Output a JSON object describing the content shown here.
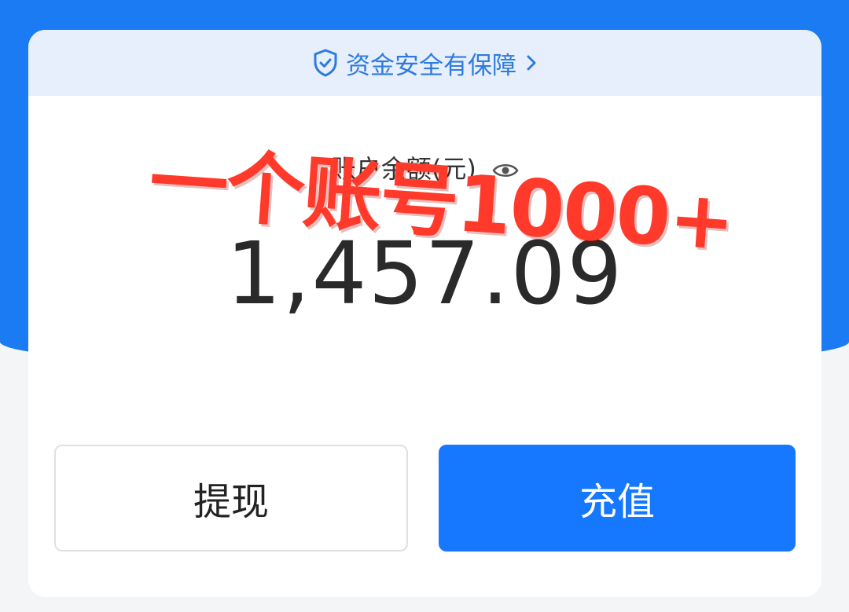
{
  "safety": {
    "label": "资金安全有保障"
  },
  "balance": {
    "label": "账户余额(元)",
    "value": "1,457.09"
  },
  "overlay": {
    "text": "一个账号1000+"
  },
  "buttons": {
    "withdraw": "提现",
    "recharge": "充值"
  },
  "colors": {
    "primary": "#1677ff",
    "header_bg": "#1a7bf2",
    "safety_bg": "#e6effb",
    "overlay": "#ff3a2a"
  },
  "icons": [
    "shield-check-icon",
    "chevron-right-icon",
    "eye-icon"
  ]
}
